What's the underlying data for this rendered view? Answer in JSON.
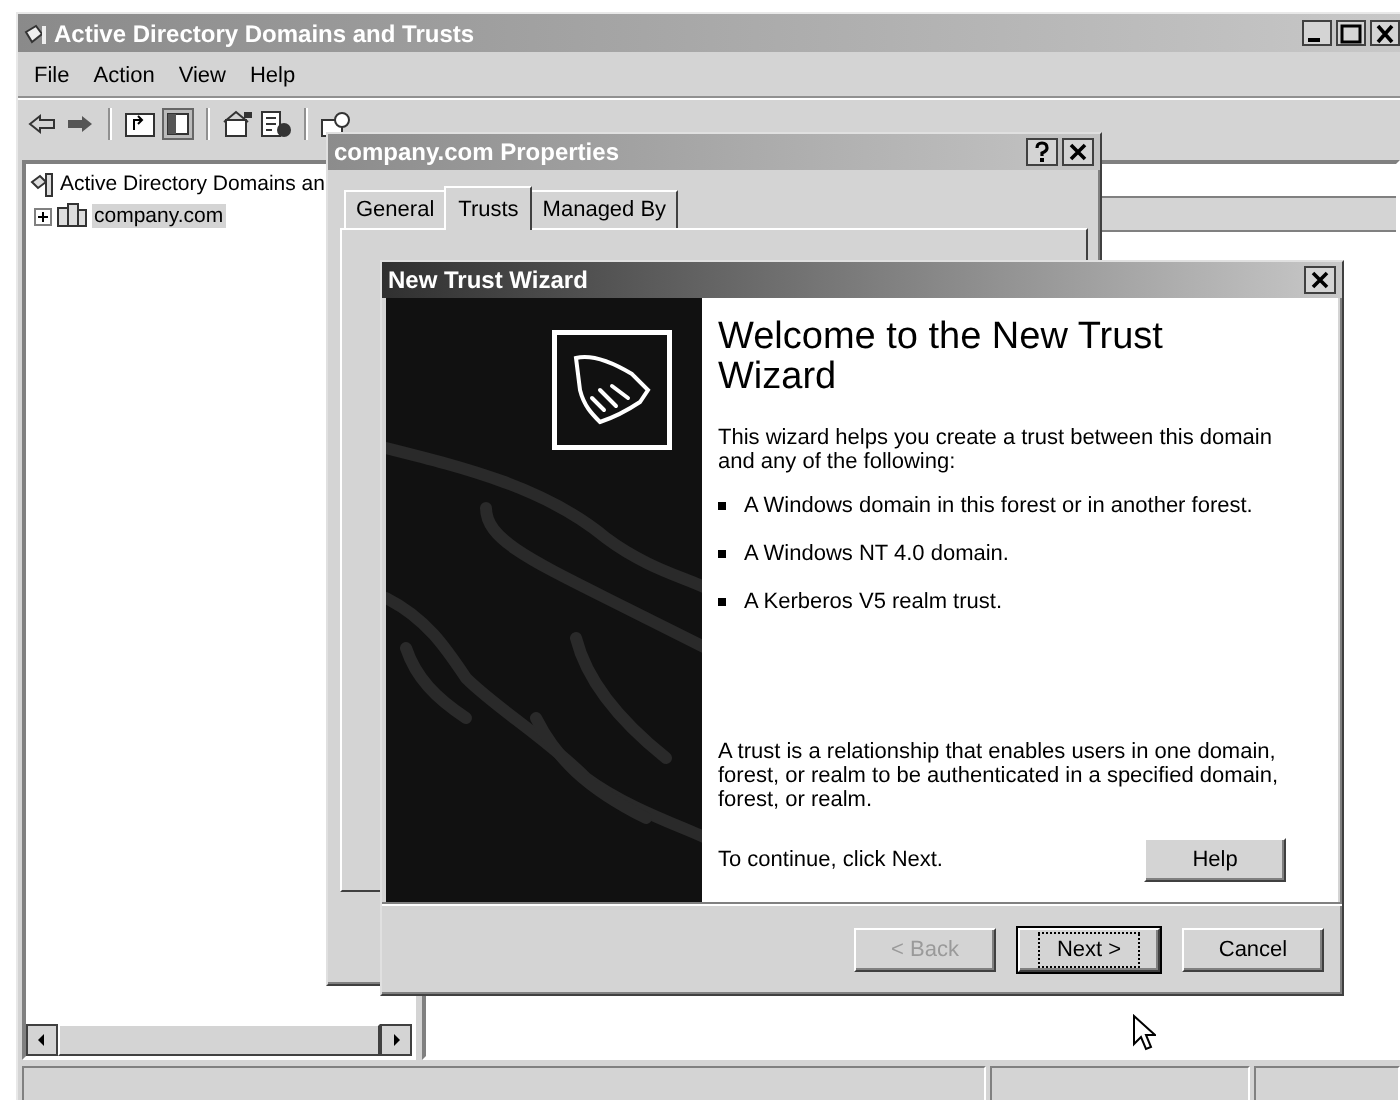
{
  "window": {
    "title": "Active Directory Domains and Trusts"
  },
  "menu": [
    "File",
    "Action",
    "View",
    "Help"
  ],
  "tree": [
    {
      "label": "Active Directory Domains an",
      "selected": false,
      "children": [
        {
          "label": "company.com",
          "selected": true,
          "expanded": false
        }
      ]
    }
  ],
  "properties_dialog": {
    "title": "company.com Properties",
    "tabs": [
      {
        "label": "General",
        "selected": false
      },
      {
        "label": "Trusts",
        "selected": true
      },
      {
        "label": "Managed By",
        "selected": false
      }
    ]
  },
  "wizard": {
    "title": "New Trust Wizard",
    "heading": "Welcome to the New Trust Wizard",
    "intro": "This wizard helps you create a trust between this domain and any of the following:",
    "bullets": [
      "A Windows domain in this forest or in another forest.",
      "A Windows NT 4.0 domain.",
      "A Kerberos V5 realm trust."
    ],
    "note": "A trust is a relationship that enables users in one domain, forest, or realm to be authenticated in a specified domain, forest, or realm.",
    "continue": "To continue, click Next.",
    "help_button": {
      "label": "Help",
      "disabled": false
    },
    "buttons": [
      {
        "label": "< Back",
        "disabled": true,
        "default": false
      },
      {
        "label": "Next >",
        "disabled": false,
        "default": true
      },
      {
        "label": "Cancel",
        "disabled": false,
        "default": false
      }
    ]
  }
}
